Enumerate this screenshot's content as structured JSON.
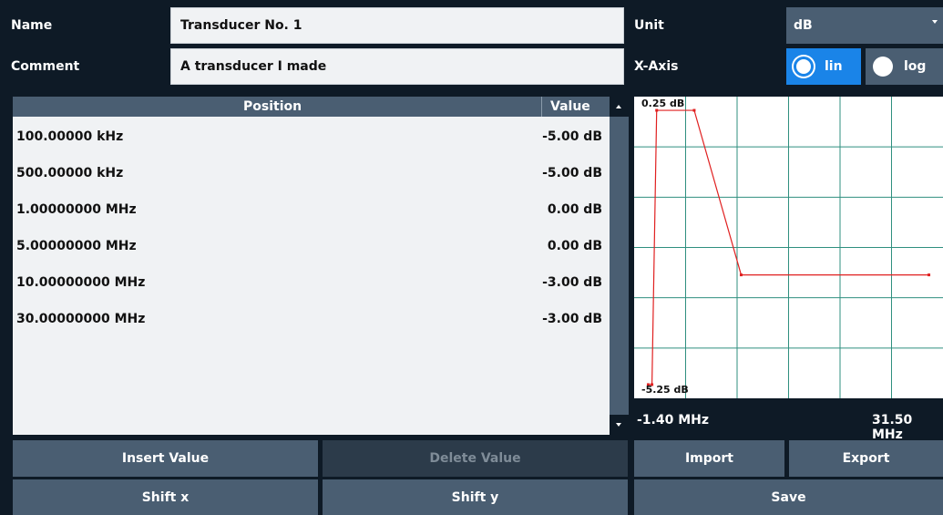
{
  "header": {
    "name_label": "Name",
    "name_value": "Transducer No. 1",
    "comment_label": "Comment",
    "comment_value": "A transducer I made",
    "unit_label": "Unit",
    "unit_value": "dB",
    "xaxis_label": "X-Axis",
    "xaxis_options": [
      "lin",
      "log"
    ],
    "xaxis_selected": "lin"
  },
  "table": {
    "col_position": "Position",
    "col_value": "Value",
    "rows": [
      {
        "position": "100.00000 kHz",
        "value": "-5.00 dB"
      },
      {
        "position": "500.00000 kHz",
        "value": "-5.00 dB"
      },
      {
        "position": "1.00000000 MHz",
        "value": "0.00 dB"
      },
      {
        "position": "5.00000000 MHz",
        "value": "0.00 dB"
      },
      {
        "position": "10.00000000 MHz",
        "value": "-3.00 dB"
      },
      {
        "position": "30.00000000 MHz",
        "value": "-3.00 dB"
      }
    ]
  },
  "graph": {
    "y_top_label": "0.25 dB",
    "y_bottom_label": "-5.25 dB",
    "x_left_label": "-1.40 MHz",
    "x_right_label": "31.50 MHz",
    "line_color": "#e02020",
    "grid_color": "#2f8f7f"
  },
  "chart_data": {
    "type": "line",
    "x": [
      0.1,
      0.5,
      1.0,
      5.0,
      10.0,
      30.0
    ],
    "series": [
      {
        "values": [
          -5.0,
          -5.0,
          0.0,
          0.0,
          -3.0,
          -3.0
        ]
      }
    ],
    "xlim": [
      -1.4,
      31.5
    ],
    "ylim": [
      -5.25,
      0.25
    ],
    "xlabel": "",
    "ylabel": "",
    "grid": true
  },
  "buttons": {
    "insert": "Insert Value",
    "delete": "Delete Value",
    "import": "Import",
    "export": "Export",
    "shift_x": "Shift x",
    "shift_y": "Shift y",
    "save": "Save"
  }
}
